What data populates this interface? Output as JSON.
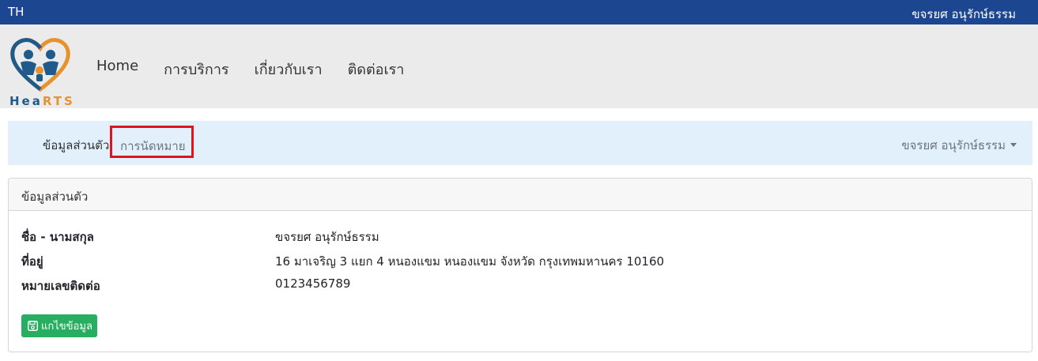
{
  "topbar": {
    "language": "TH",
    "user_name": "ขจรยศ อนุรักษ์ธรรม"
  },
  "logo": {
    "text_part1": "Hea",
    "text_part2": "RTS"
  },
  "nav": {
    "items": [
      {
        "label": "Home"
      },
      {
        "label": "การบริการ"
      },
      {
        "label": "เกี่ยวกับเรา"
      },
      {
        "label": "ติดต่อเรา"
      }
    ]
  },
  "subnav": {
    "profile_label": "ข้อมูลส่วนตัว",
    "appointment_label": "การนัดหมาย",
    "user_dropdown": "ขจรยศ อนุรักษ์ธรรม"
  },
  "card": {
    "title": "ข้อมูลส่วนตัว",
    "fields": [
      {
        "label": "ชื่อ - นามสกุล",
        "value": "ขจรยศ อนุรักษ์ธรรม"
      },
      {
        "label": "ที่อยู่",
        "value": "16 มาเจริญ 3 แยก 4 หนองแขม หนองแขม จังหวัด กรุงเทพมหานคร 10160"
      },
      {
        "label": "หมายเลขติดต่อ",
        "value": "0123456789"
      }
    ],
    "edit_button": "แกไขข้อมูล"
  },
  "colors": {
    "topbar": "#1c4690",
    "highlight_border": "#e0141e",
    "button": "#27ae60"
  }
}
